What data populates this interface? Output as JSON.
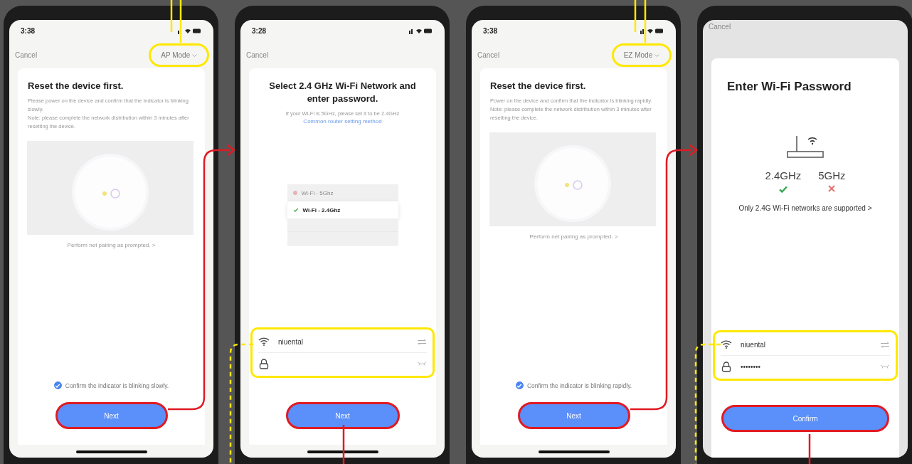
{
  "phones": [
    {
      "kind": "reset",
      "time": "3:38",
      "cancel": "Cancel",
      "mode": {
        "label": "AP Mode",
        "callout": true
      },
      "title": "Reset the device first.",
      "paragraphs": [
        "Please power on the device and confirm that the indicator is blinking slowly.",
        "Note: please complete the network distribution within 3 minutes after resetting the device."
      ],
      "pairing_link": "Perform net pairing as prompted. >",
      "confirm": {
        "label": "Confirm the indicator is blinking slowly.",
        "checked": true
      },
      "button": {
        "label": "Next",
        "callout": true
      }
    },
    {
      "kind": "network",
      "time": "3:28",
      "cancel": "Cancel",
      "title": "Select 2.4 GHz Wi-Fi Network and enter password.",
      "hint": "If your Wi-Fi is 5GHz, please set it to be 2.4GHz",
      "hint_link": "Common router setting method",
      "wifi_list": [
        {
          "label": "Wi-Fi - 5Ghz",
          "selected": false
        },
        {
          "label": "Wi-Fi - 2.4Ghz",
          "selected": true
        }
      ],
      "fields": {
        "callout": true,
        "ssid": "niuental"
      },
      "button": {
        "label": "Next",
        "callout": true
      }
    },
    {
      "kind": "reset",
      "time": "3:38",
      "cancel": "Cancel",
      "mode": {
        "label": "EZ Mode",
        "callout": true
      },
      "title": "Reset the device first.",
      "paragraphs": [
        "Power on the device and confirm that the indicator is blinking rapidly.",
        "Note: please complete the network distribution within 3 minutes after resetting the device."
      ],
      "pairing_link": "Perform net pairing as prompted. >",
      "confirm": {
        "label": "Confirm the indicator is blinking rapidly.",
        "checked": true
      },
      "button": {
        "label": "Next",
        "callout": true
      }
    },
    {
      "kind": "password",
      "cancel": "Cancel",
      "title": "Enter Wi-Fi Password",
      "bands": [
        {
          "label": "2.4GHz",
          "supported": true
        },
        {
          "label": "5GHz",
          "supported": false
        }
      ],
      "note": "Only 2.4G Wi-Fi networks are supported >",
      "fields": {
        "callout": true,
        "ssid": "niuental",
        "password": "••••••••"
      },
      "button": {
        "label": "Confirm",
        "callout": true
      }
    }
  ]
}
